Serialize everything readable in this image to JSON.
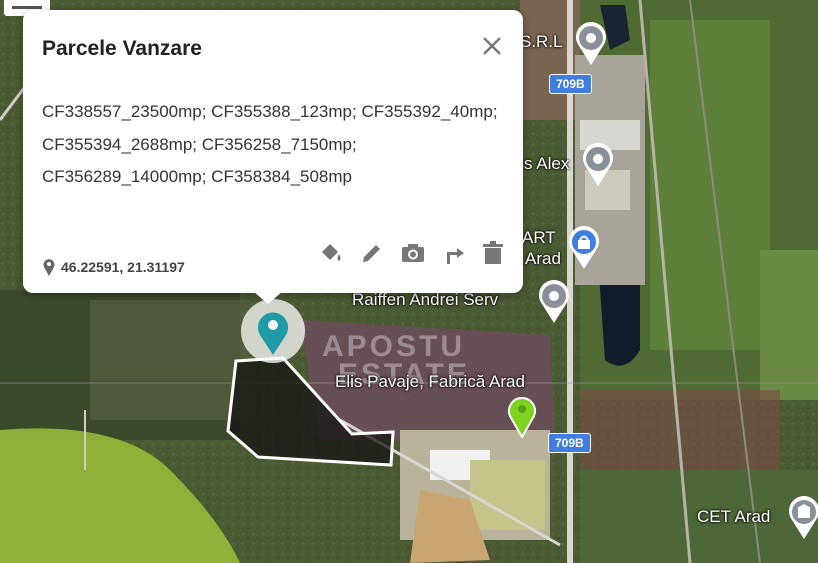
{
  "popup": {
    "title": "Parcele Vanzare",
    "description": "CF338557_23500mp; CF355388_123mp; CF355392_40mp; CF355394_2688mp; CF356258_7150mp; CF356289_14000mp; CF358384_508mp",
    "coordinates": "46.22591, 21.31197",
    "tools": [
      "paint-bucket-icon",
      "pencil-icon",
      "camera-icon",
      "directions-icon",
      "trash-icon"
    ]
  },
  "map": {
    "pois": [
      {
        "label": "S.R.L"
      },
      {
        "label": "s Alex"
      },
      {
        "label": "ART"
      },
      {
        "label": "Arad"
      },
      {
        "label": "Raiffen Andrei Serv"
      },
      {
        "label": "Elis Pavaje, Fabrică Arad"
      },
      {
        "label": "CET Arad"
      }
    ],
    "roads": [
      "709B",
      "709B"
    ],
    "watermark": [
      "APOSTU",
      "ESTATE"
    ]
  },
  "colors": {
    "marker_teal": "#1f9aa6",
    "marker_green": "#7ed321",
    "road_blue": "#3f7de0",
    "popup_bg": "#ffffff"
  }
}
